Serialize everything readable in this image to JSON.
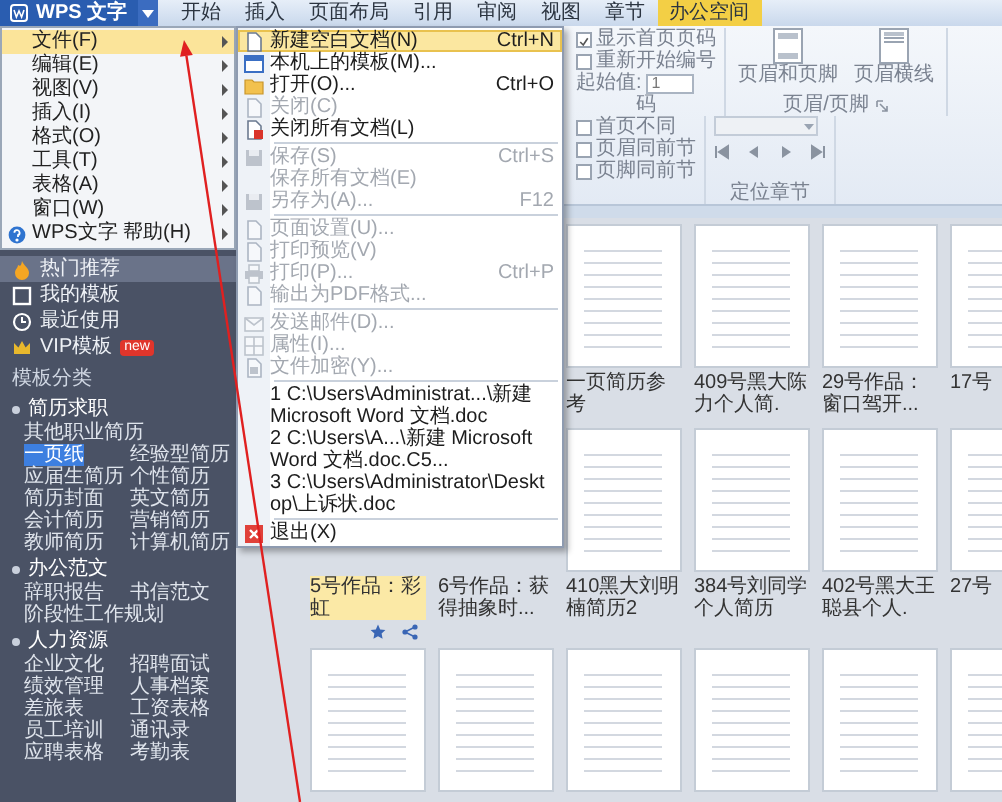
{
  "app_menu_button": {
    "label": "WPS 文字"
  },
  "tabs": [
    {
      "label": "开始",
      "selected": false
    },
    {
      "label": "插入",
      "selected": false
    },
    {
      "label": "页面布局",
      "selected": false
    },
    {
      "label": "引用",
      "selected": false
    },
    {
      "label": "审阅",
      "selected": false
    },
    {
      "label": "视图",
      "selected": false
    },
    {
      "label": "章节",
      "selected": false
    },
    {
      "label": "办公空间",
      "selected": true
    }
  ],
  "main_menu": [
    {
      "kind": "plain",
      "label": "文件(F)",
      "selected": true
    },
    {
      "kind": "plain",
      "label": "编辑(E)",
      "selected": false
    },
    {
      "kind": "plain",
      "label": "视图(V)",
      "selected": false
    },
    {
      "kind": "plain",
      "label": "插入(I)",
      "selected": false
    },
    {
      "kind": "plain",
      "label": "格式(O)",
      "selected": false
    },
    {
      "kind": "plain",
      "label": "工具(T)",
      "selected": false
    },
    {
      "kind": "plain",
      "label": "表格(A)",
      "selected": false
    },
    {
      "kind": "plain",
      "label": "窗口(W)",
      "selected": false
    },
    {
      "kind": "help",
      "label": "WPS文字 帮助(H)",
      "selected": false
    }
  ],
  "file_menu": [
    {
      "kind": "item",
      "label": "新建空白文档(N)",
      "shortcut": "Ctrl+N",
      "selected": true,
      "disabled": false
    },
    {
      "kind": "item",
      "label": "本机上的模板(M)...",
      "selected": false,
      "disabled": false
    },
    {
      "kind": "item",
      "label": "打开(O)...",
      "shortcut": "Ctrl+O",
      "selected": false,
      "disabled": false
    },
    {
      "kind": "item",
      "label": "关闭(C)",
      "selected": false,
      "disabled": true
    },
    {
      "kind": "item",
      "label": "关闭所有文档(L)",
      "selected": false,
      "disabled": false
    },
    {
      "kind": "separator"
    },
    {
      "kind": "item",
      "label": "保存(S)",
      "shortcut": "Ctrl+S",
      "selected": false,
      "disabled": true
    },
    {
      "kind": "item",
      "label": "保存所有文档(E)",
      "selected": false,
      "disabled": true
    },
    {
      "kind": "item",
      "label": "另存为(A)...",
      "shortcut": "F12",
      "selected": false,
      "disabled": true
    },
    {
      "kind": "separator"
    },
    {
      "kind": "item",
      "label": "页面设置(U)...",
      "selected": false,
      "disabled": true
    },
    {
      "kind": "item",
      "label": "打印预览(V)",
      "selected": false,
      "disabled": true
    },
    {
      "kind": "item",
      "label": "打印(P)...",
      "shortcut": "Ctrl+P",
      "selected": false,
      "disabled": true
    },
    {
      "kind": "item",
      "label": "输出为PDF格式...",
      "selected": false,
      "disabled": true
    },
    {
      "kind": "separator"
    },
    {
      "kind": "item",
      "label": "发送邮件(D)...",
      "selected": false,
      "disabled": true
    },
    {
      "kind": "item",
      "label": "属性(I)...",
      "selected": false,
      "disabled": true
    },
    {
      "kind": "item",
      "label": "文件加密(Y)...",
      "selected": false,
      "disabled": true
    },
    {
      "kind": "separator"
    },
    {
      "kind": "recent",
      "label": "1 C:\\Users\\Administrat...\\新建 Microsoft Word 文档.doc",
      "selected": false,
      "disabled": false
    },
    {
      "kind": "recent",
      "label": "2 C:\\Users\\A...\\新建 Microsoft Word 文档.doc.C5...",
      "selected": false,
      "disabled": false
    },
    {
      "kind": "recent",
      "label": "3 C:\\Users\\Administrator\\Desktop\\上诉状.doc",
      "selected": false,
      "disabled": false
    },
    {
      "kind": "separator"
    },
    {
      "kind": "item",
      "label": "退出(X)",
      "selected": false,
      "disabled": false
    }
  ],
  "sidebar": {
    "nav": [
      {
        "label": "热门推荐",
        "selected": true
      },
      {
        "label": "我的模板",
        "selected": false
      },
      {
        "label": "最近使用",
        "selected": false
      },
      {
        "label": "VIP模板",
        "selected": false,
        "badge": "new"
      }
    ],
    "section_title": "模板分类",
    "categories": [
      {
        "title": "简历求职",
        "items": [
          {
            "label": "其他职业简历",
            "selected": false
          },
          {
            "label": "一页纸",
            "selected": true
          },
          {
            "label": "经验型简历",
            "selected": false
          },
          {
            "label": "应届生简历",
            "selected": false
          },
          {
            "label": "个性简历",
            "selected": false
          },
          {
            "label": "简历封面",
            "selected": false
          },
          {
            "label": "英文简历",
            "selected": false
          },
          {
            "label": "会计简历",
            "selected": false
          },
          {
            "label": "营销简历",
            "selected": false
          },
          {
            "label": "教师简历",
            "selected": false
          },
          {
            "label": "计算机简历",
            "selected": false
          }
        ]
      },
      {
        "title": "办公范文",
        "items": [
          {
            "label": "辞职报告",
            "selected": false
          },
          {
            "label": "书信范文",
            "selected": false
          },
          {
            "label": "阶段性工作规划",
            "selected": false
          }
        ]
      },
      {
        "title": "人力资源",
        "items": [
          {
            "label": "企业文化",
            "selected": false
          },
          {
            "label": "招聘面试",
            "selected": false
          },
          {
            "label": "绩效管理",
            "selected": false
          },
          {
            "label": "人事档案",
            "selected": false
          },
          {
            "label": "差旅表",
            "selected": false
          },
          {
            "label": "工资表格",
            "selected": false
          },
          {
            "label": "员工培训",
            "selected": false
          },
          {
            "label": "通讯录",
            "selected": false
          },
          {
            "label": "应聘表格",
            "selected": false
          },
          {
            "label": "考勤表",
            "selected": false
          }
        ]
      }
    ]
  },
  "ribbon": {
    "page_number": {
      "label": "码",
      "checkboxes": [
        {
          "label": "显示首页页码",
          "checked": true
        },
        {
          "label": "重新开始编号",
          "checked": false
        }
      ],
      "start_label": "起始值:",
      "start_value": "1"
    },
    "header_footer": {
      "label": "页眉/页脚",
      "buttons": [
        "页眉和页脚",
        "页眉横线"
      ],
      "checkboxes": [
        {
          "label": "首页不同",
          "checked": false
        },
        {
          "label": "页眉同前节",
          "checked": false
        },
        {
          "label": "页脚同前节",
          "checked": false
        }
      ]
    },
    "section_nav": {
      "label": "定位章节"
    }
  },
  "template_rows": [
    [
      {
        "kind": "thumbnail",
        "caption": "一页简历参考",
        "highlighted": false
      },
      {
        "kind": "thumbnail",
        "caption": "409号黑大陈力个人简.",
        "highlighted": false
      },
      {
        "kind": "thumbnail",
        "caption": "29号作品：窗口驾开...",
        "highlighted": false
      },
      {
        "kind": "thumbnail",
        "caption": "17号",
        "highlighted": false
      }
    ],
    [
      {
        "kind": "caption",
        "caption": "5号作品：彩虹",
        "highlighted": true
      },
      {
        "kind": "caption",
        "caption": "6号作品：获得抽象时...",
        "highlighted": false
      },
      {
        "kind": "thumbnail",
        "caption": "410黑大刘明楠简历2",
        "highlighted": false
      },
      {
        "kind": "thumbnail",
        "caption": "384号刘同学个人简历",
        "highlighted": false
      },
      {
        "kind": "thumbnail",
        "caption": "402号黑大王聪县个人.",
        "highlighted": false
      },
      {
        "kind": "thumbnail",
        "caption": "27号",
        "highlighted": false
      }
    ],
    [
      {
        "kind": "thumbnail"
      },
      {
        "kind": "thumbnail"
      },
      {
        "kind": "thumbnail"
      },
      {
        "kind": "thumbnail"
      },
      {
        "kind": "thumbnail"
      },
      {
        "kind": "thumbnail"
      }
    ]
  ]
}
